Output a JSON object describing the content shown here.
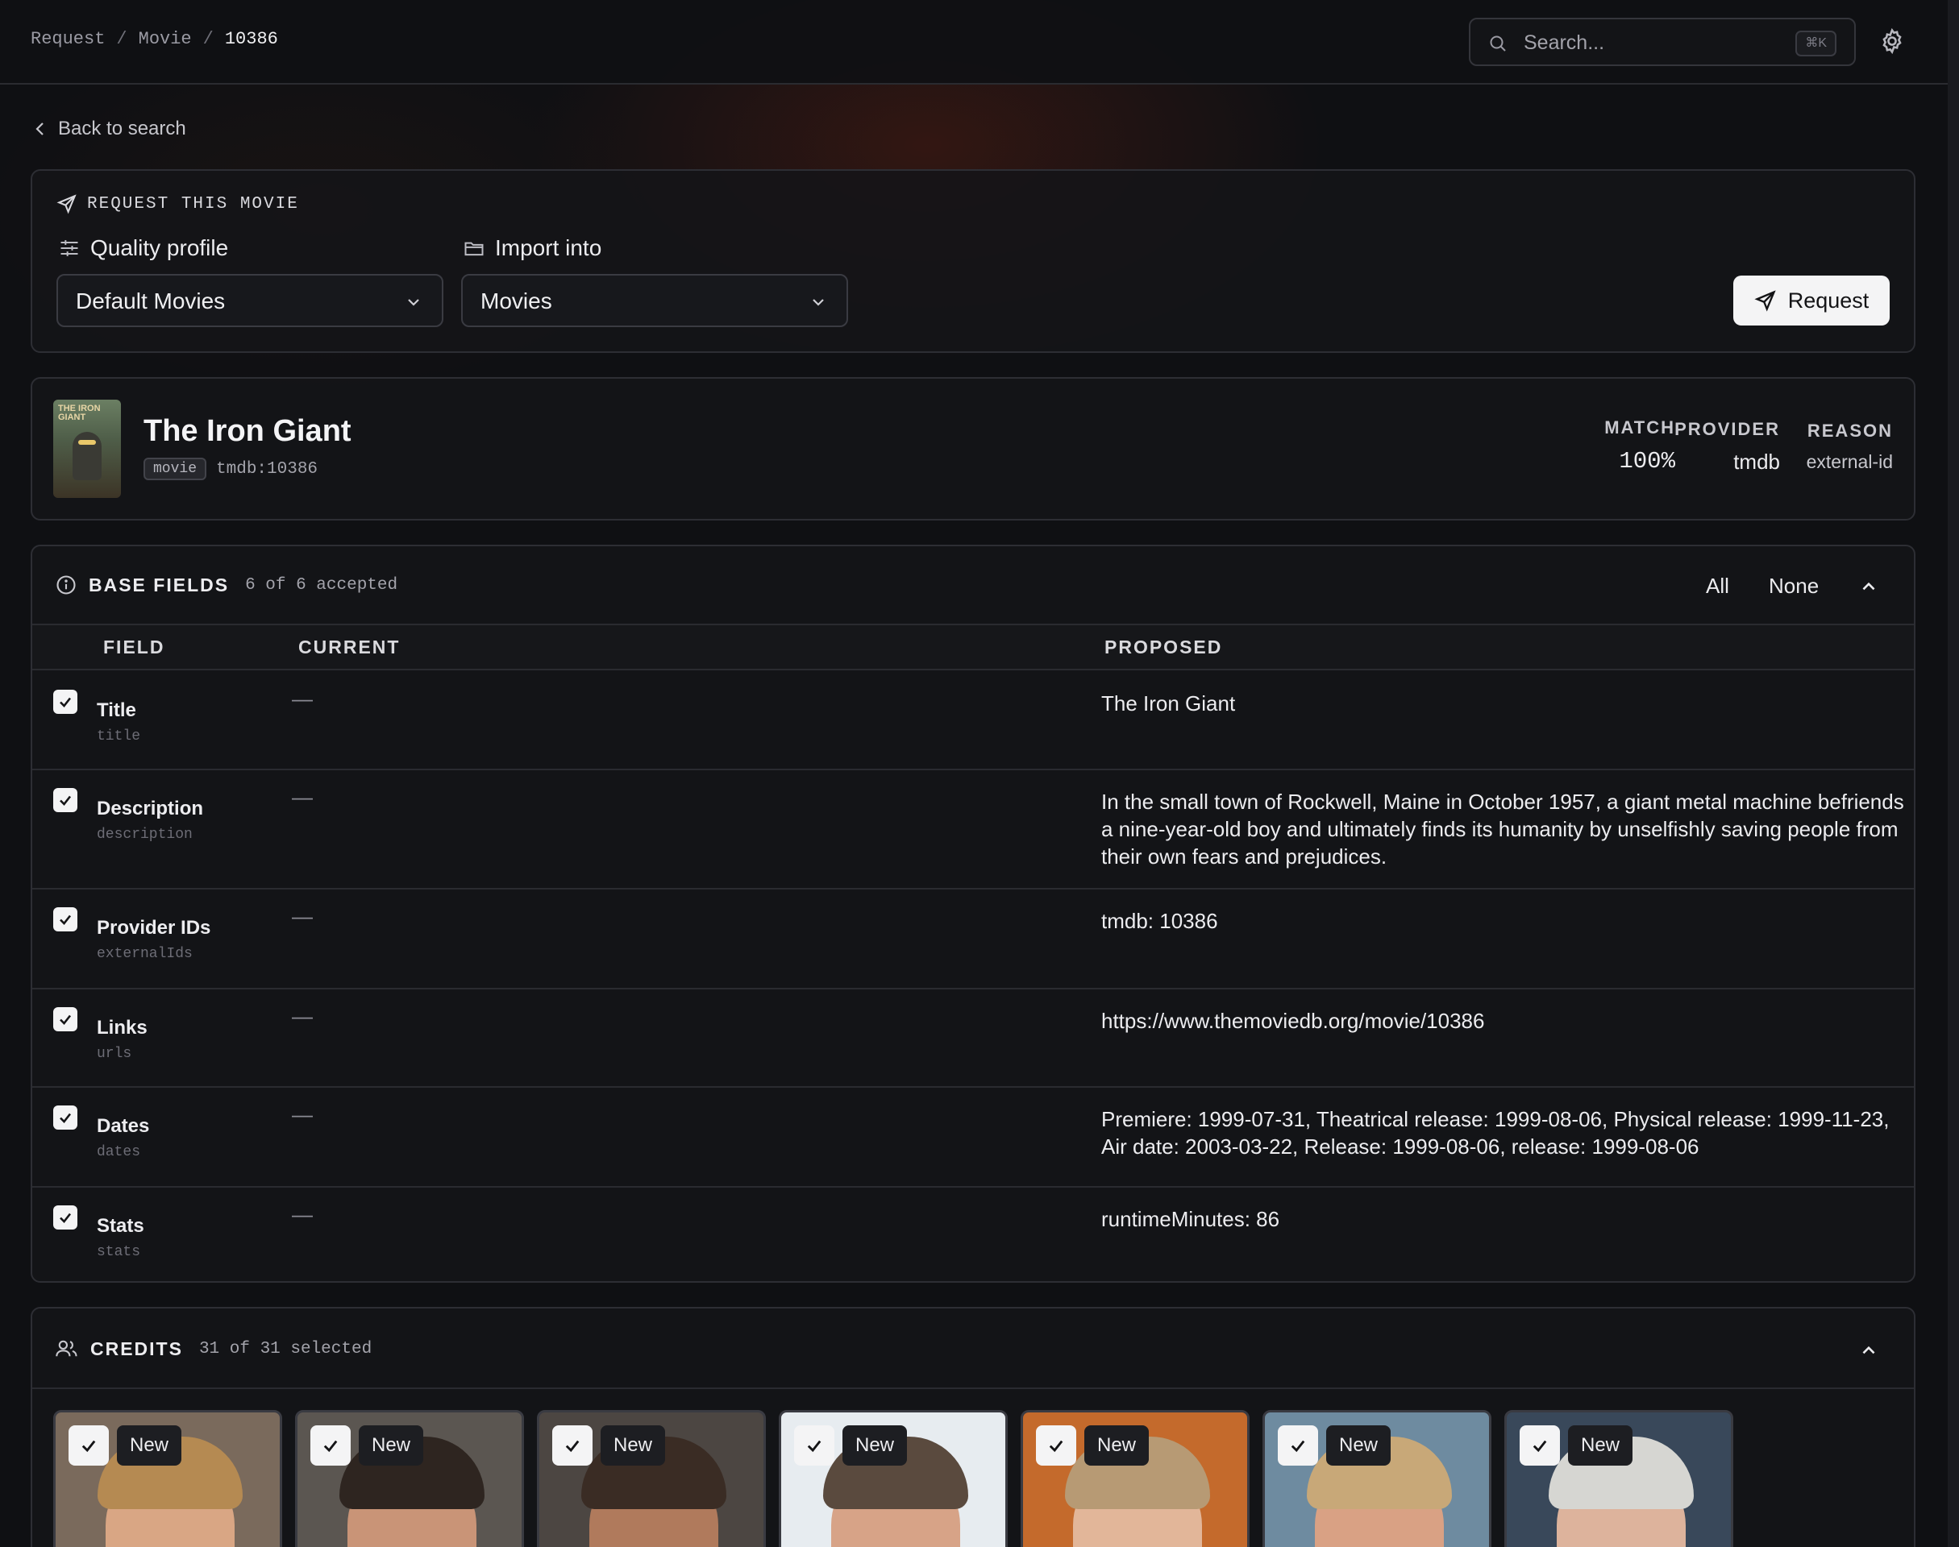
{
  "breadcrumb": {
    "items": [
      "Request",
      "Movie",
      "10386"
    ]
  },
  "search": {
    "placeholder": "Search...",
    "shortcut": "⌘K"
  },
  "back_label": "Back to search",
  "request": {
    "title": "REQUEST THIS MOVIE",
    "quality_label": "Quality profile",
    "quality_value": "Default Movies",
    "import_label": "Import into",
    "import_value": "Movies",
    "button_label": "Request"
  },
  "movie": {
    "title": "The Iron Giant",
    "type_tag": "movie",
    "id": "tmdb:10386",
    "poster_text": "THE IRON GIANT",
    "match_label": "MATCH",
    "match_value": "100%",
    "provider_label": "PROVIDER",
    "provider_value": "tmdb",
    "reason_label": "REASON",
    "reason_value": "external-id"
  },
  "base_fields": {
    "title": "BASE FIELDS",
    "count": "6 of 6 accepted",
    "all_label": "All",
    "none_label": "None",
    "columns": {
      "field": "FIELD",
      "current": "CURRENT",
      "proposed": "PROPOSED"
    },
    "rows": [
      {
        "name": "Title",
        "key": "title",
        "current": "—",
        "proposed": "The Iron Giant",
        "checked": true
      },
      {
        "name": "Description",
        "key": "description",
        "current": "—",
        "proposed": "In the small town of Rockwell, Maine in October 1957, a giant metal machine befriends a nine-year-old boy and ultimately finds its humanity by unselfishly saving people from their own fears and prejudices.",
        "checked": true
      },
      {
        "name": "Provider IDs",
        "key": "externalIds",
        "current": "—",
        "proposed": "tmdb: 10386",
        "checked": true
      },
      {
        "name": "Links",
        "key": "urls",
        "current": "—",
        "proposed": "https://www.themoviedb.org/movie/10386",
        "checked": true
      },
      {
        "name": "Dates",
        "key": "dates",
        "current": "—",
        "proposed": "Premiere: 1999-07-31, Theatrical release: 1999-08-06, Physical release: 1999-11-23, Air date: 2003-03-22, Release: 1999-08-06, release: 1999-08-06",
        "checked": true
      },
      {
        "name": "Stats",
        "key": "stats",
        "current": "—",
        "proposed": "runtimeMinutes: 86",
        "checked": true
      }
    ]
  },
  "credits": {
    "title": "CREDITS",
    "count": "31 of 31 selected",
    "cards": [
      {
        "badge": "New",
        "bg": "#7a6a5c",
        "skin": "#d9a684",
        "hair": "#b58a52"
      },
      {
        "badge": "New",
        "bg": "#5b5651",
        "skin": "#c99477",
        "hair": "#2e2520"
      },
      {
        "badge": "New",
        "bg": "#4c4642",
        "skin": "#b07a5c",
        "hair": "#3a2c24"
      },
      {
        "badge": "New",
        "bg": "#e7ecf0",
        "skin": "#d7a387",
        "hair": "#5a4a3e"
      },
      {
        "badge": "New",
        "bg": "#c46a2c",
        "skin": "#e2b699",
        "hair": "#b79a74"
      },
      {
        "badge": "New",
        "bg": "#6e8ba0",
        "skin": "#d9a184",
        "hair": "#c8a878"
      },
      {
        "badge": "New",
        "bg": "#39485a",
        "skin": "#ddb39c",
        "hair": "#d6d6d2"
      }
    ]
  }
}
